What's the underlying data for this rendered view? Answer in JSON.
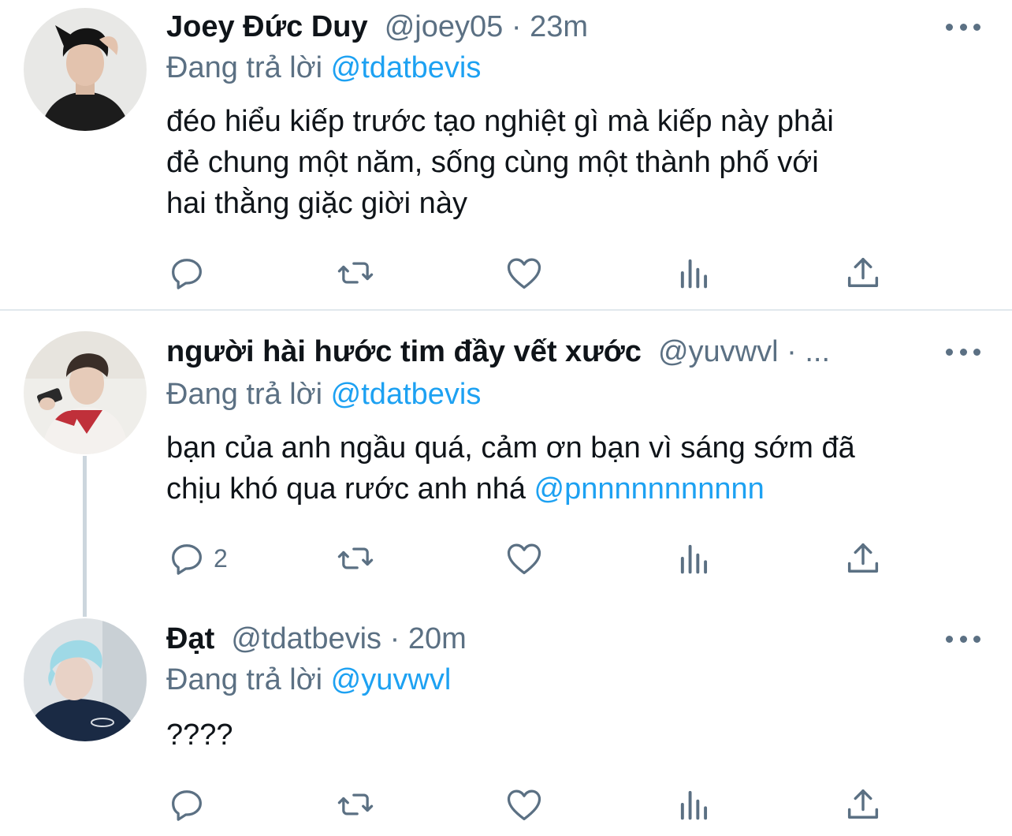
{
  "replying_prefix": "Đang trả lời",
  "tweets": [
    {
      "name": "Joey Đức Duy",
      "handle": "@joey05",
      "sep": " · ",
      "time": "23m",
      "reply_to": "@tdatbevis",
      "text_lines": [
        "đéo hiểu kiếp trước tạo nghiệt gì mà kiếp này phải",
        "đẻ chung một năm, sống cùng một thành phố với",
        "hai thằng giặc giời này"
      ],
      "reply_count": ""
    },
    {
      "name": "người hài hước tim đầy vết xước",
      "handle": "@yuvwvl",
      "sep": " · ",
      "time": "...",
      "reply_to": "@tdatbevis",
      "text_line1": "bạn của anh ngầu quá, cảm ơn bạn vì sáng sớm đã",
      "text_line2_prefix": "chịu khó qua rước anh nhá ",
      "text_line2_mention": "@pnnnnnnnnnnn",
      "reply_count": "2"
    },
    {
      "name": "Đạt",
      "handle": "@tdatbevis",
      "sep": " · ",
      "time": "20m",
      "reply_to": "@yuvwvl",
      "text_lines": [
        "????"
      ],
      "reply_count": ""
    }
  ],
  "icons": {
    "reply": "reply-icon",
    "retweet": "retweet-icon",
    "like": "like-icon",
    "analytics": "analytics-icon",
    "share": "share-icon",
    "more": "more-icon"
  },
  "colors": {
    "mention": "#1da1f2",
    "secondary_text": "#5b7083",
    "divider": "#e1e8ed",
    "thread_line": "#ccd6dd"
  }
}
